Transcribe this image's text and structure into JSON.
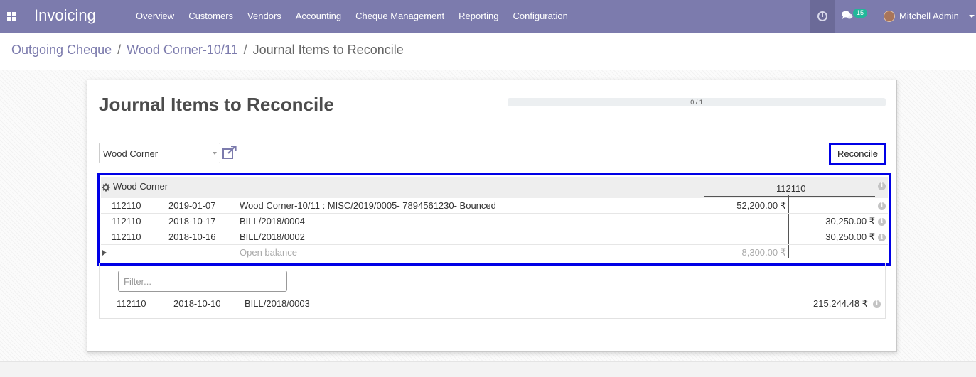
{
  "app": {
    "title": "Invoicing"
  },
  "menu": [
    {
      "label": "Overview"
    },
    {
      "label": "Customers"
    },
    {
      "label": "Vendors"
    },
    {
      "label": "Accounting"
    },
    {
      "label": "Cheque Management"
    },
    {
      "label": "Reporting"
    },
    {
      "label": "Configuration"
    }
  ],
  "systray": {
    "chat_badge": "15",
    "user_name": "Mitchell Admin"
  },
  "breadcrumb": {
    "item1": "Outgoing Cheque",
    "item2": "Wood Corner-10/11",
    "sep": "/",
    "current": "Journal Items to Reconcile"
  },
  "page": {
    "title": "Journal Items to Reconcile",
    "progress_text": "0 / 1",
    "progress_fraction": 0,
    "partner": "Wood Corner",
    "reconcile_label": "Reconcile"
  },
  "proposition": {
    "partner": "Wood Corner",
    "account_code": "112110",
    "rows": [
      {
        "account": "112110",
        "date": "2019-01-07",
        "label": "Wood Corner-10/11 : MISC/2019/0005- 7894561230- Bounced",
        "debit": "52,200.00 ₹",
        "credit": ""
      },
      {
        "account": "112110",
        "date": "2018-10-17",
        "label": "BILL/2018/0004",
        "debit": "",
        "credit": "30,250.00 ₹"
      },
      {
        "account": "112110",
        "date": "2018-10-16",
        "label": "BILL/2018/0002",
        "debit": "",
        "credit": "30,250.00 ₹"
      }
    ],
    "open_balance_label": "Open balance",
    "open_balance_value": "8,300.00 ₹"
  },
  "lower": {
    "filter_placeholder": "Filter...",
    "row": {
      "account": "112110",
      "date": "2018-10-10",
      "label": "BILL/2018/0003",
      "credit": "215,244.48 ₹"
    }
  },
  "colors": {
    "brand": "#7c7bad",
    "highlight": "#0000e6",
    "badge": "#21b799"
  }
}
